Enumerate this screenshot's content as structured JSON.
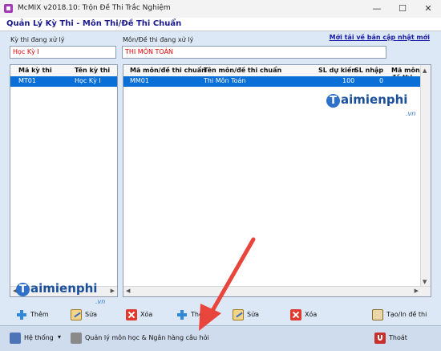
{
  "window": {
    "title": "McMIX v2018.10: Trộn Đề Thi Trắc Nghiệm",
    "minimize": "—",
    "maximize": "☐",
    "close": "✕"
  },
  "header": {
    "title": "Quản Lý Kỳ Thi - Môn Thi/Đề Thi Chuẩn"
  },
  "left_field": {
    "label": "Kỳ thi đang xử lý",
    "value": "Học Kỳ I"
  },
  "right_field": {
    "label": "Môn/Đề thi đang xử lý",
    "value": "THI MÔN TOÁN"
  },
  "update_link": "Mới tải về bản cập nhật mới",
  "exam_table": {
    "columns": [
      "Mã kỳ thi",
      "Tên kỳ thi"
    ],
    "rows": [
      [
        "MT01",
        "Học Kỳ I"
      ]
    ]
  },
  "subject_table": {
    "columns": [
      "Mã môn/đề thi chuẩn",
      "Tên môn/đề thi chuẩn",
      "SL dự kiến",
      "SL nhập",
      "Mã môn/đề thi"
    ],
    "rows": [
      [
        "MM01",
        "Thi Môn Toán",
        "100",
        "0",
        ""
      ]
    ]
  },
  "left_actions": {
    "add": "Thêm",
    "edit": "Sửa",
    "delete": "Xóa"
  },
  "right_actions": {
    "add": "Thêm",
    "edit": "Sửa",
    "delete": "Xóa",
    "export": "Tạo/In đề thi"
  },
  "bottom": {
    "system": "Hệ thống",
    "bank": "Quản lý môn học & Ngân hàng câu hỏi",
    "exit": "Thoát"
  },
  "watermark": {
    "letter": "T",
    "text": "aimienphi",
    "suffix": ".vn"
  },
  "colors": {
    "selected_row": "#0a6fd6",
    "header_title": "#1b1b8f",
    "arrow": "#e8453c"
  }
}
